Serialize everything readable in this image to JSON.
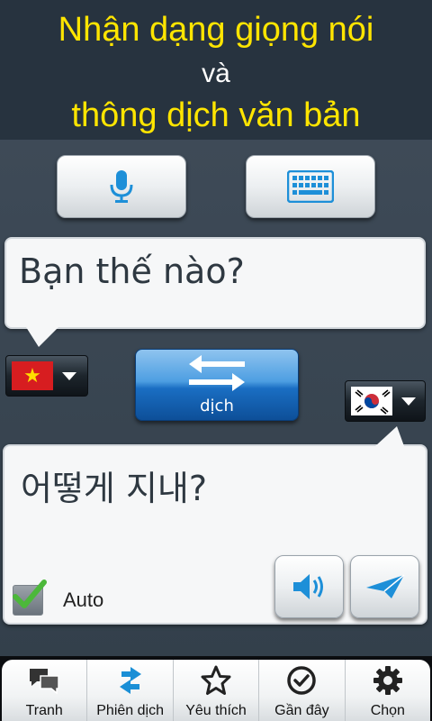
{
  "header": {
    "line1": "Nhận dạng giọng nói",
    "line2": "và",
    "line3": "thông dịch văn bản"
  },
  "input_modes": {
    "mic_icon": "microphone-icon",
    "keyboard_icon": "keyboard-icon"
  },
  "source": {
    "text": "Bạn thế nào?",
    "language_flag": "vietnam-flag"
  },
  "target": {
    "text": "어떻게 지내?",
    "language_flag": "south-korea-flag"
  },
  "translate_button": {
    "label": "dịch"
  },
  "auto": {
    "label": "Auto",
    "checked": true
  },
  "nav": {
    "items": [
      {
        "label": "Tranh",
        "icon": "chat-bubbles-icon"
      },
      {
        "label": "Phiên dịch",
        "icon": "swap-arrows-icon",
        "active": true
      },
      {
        "label": "Yêu thích",
        "icon": "star-icon"
      },
      {
        "label": "Gần đây",
        "icon": "check-circle-icon"
      },
      {
        "label": "Chọn",
        "icon": "gear-icon"
      }
    ]
  },
  "colors": {
    "header_text": "#ffe500",
    "accent_blue": "#1a8fd6",
    "check_green": "#4cb83a"
  }
}
